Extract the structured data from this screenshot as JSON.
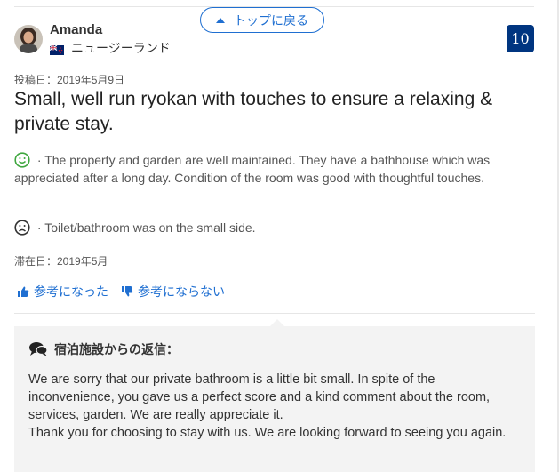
{
  "back_to_top": {
    "label": "トップに戻る"
  },
  "reviewer": {
    "name": "Amanda",
    "country": "ニュージーランド",
    "flag": "new-zealand-flag"
  },
  "score": "10",
  "review": {
    "posted_date": "投稿日：2019年5月9日",
    "title": "Small, well run ryokan with touches to ensure a relaxing & private stay.",
    "positive": "The property and garden are well maintained. They have a bathhouse which was appreciated after a long day. Condition of the room was good with thoughtful touches.",
    "negative": "Toilet/bathroom was on the small side.",
    "separator": " · ",
    "stay_date": "滞在日：2019年5月"
  },
  "helpful": {
    "yes_label": "参考になった",
    "no_label": "参考にならない"
  },
  "reply": {
    "header": "宿泊施設からの返信：",
    "text": "We are sorry that our private bathroom is a little bit small. In spite of the inconvenience, you gave us a perfect score and a kind comment about the room, services, garden. We are really appreciate it.\nThank you for choosing to stay with us. We are looking forward to seeing you again."
  },
  "colors": {
    "link": "#1f6fd1",
    "score_bg": "#003580",
    "positive": "#3fa73f",
    "reply_bg": "#f3f3f3"
  }
}
